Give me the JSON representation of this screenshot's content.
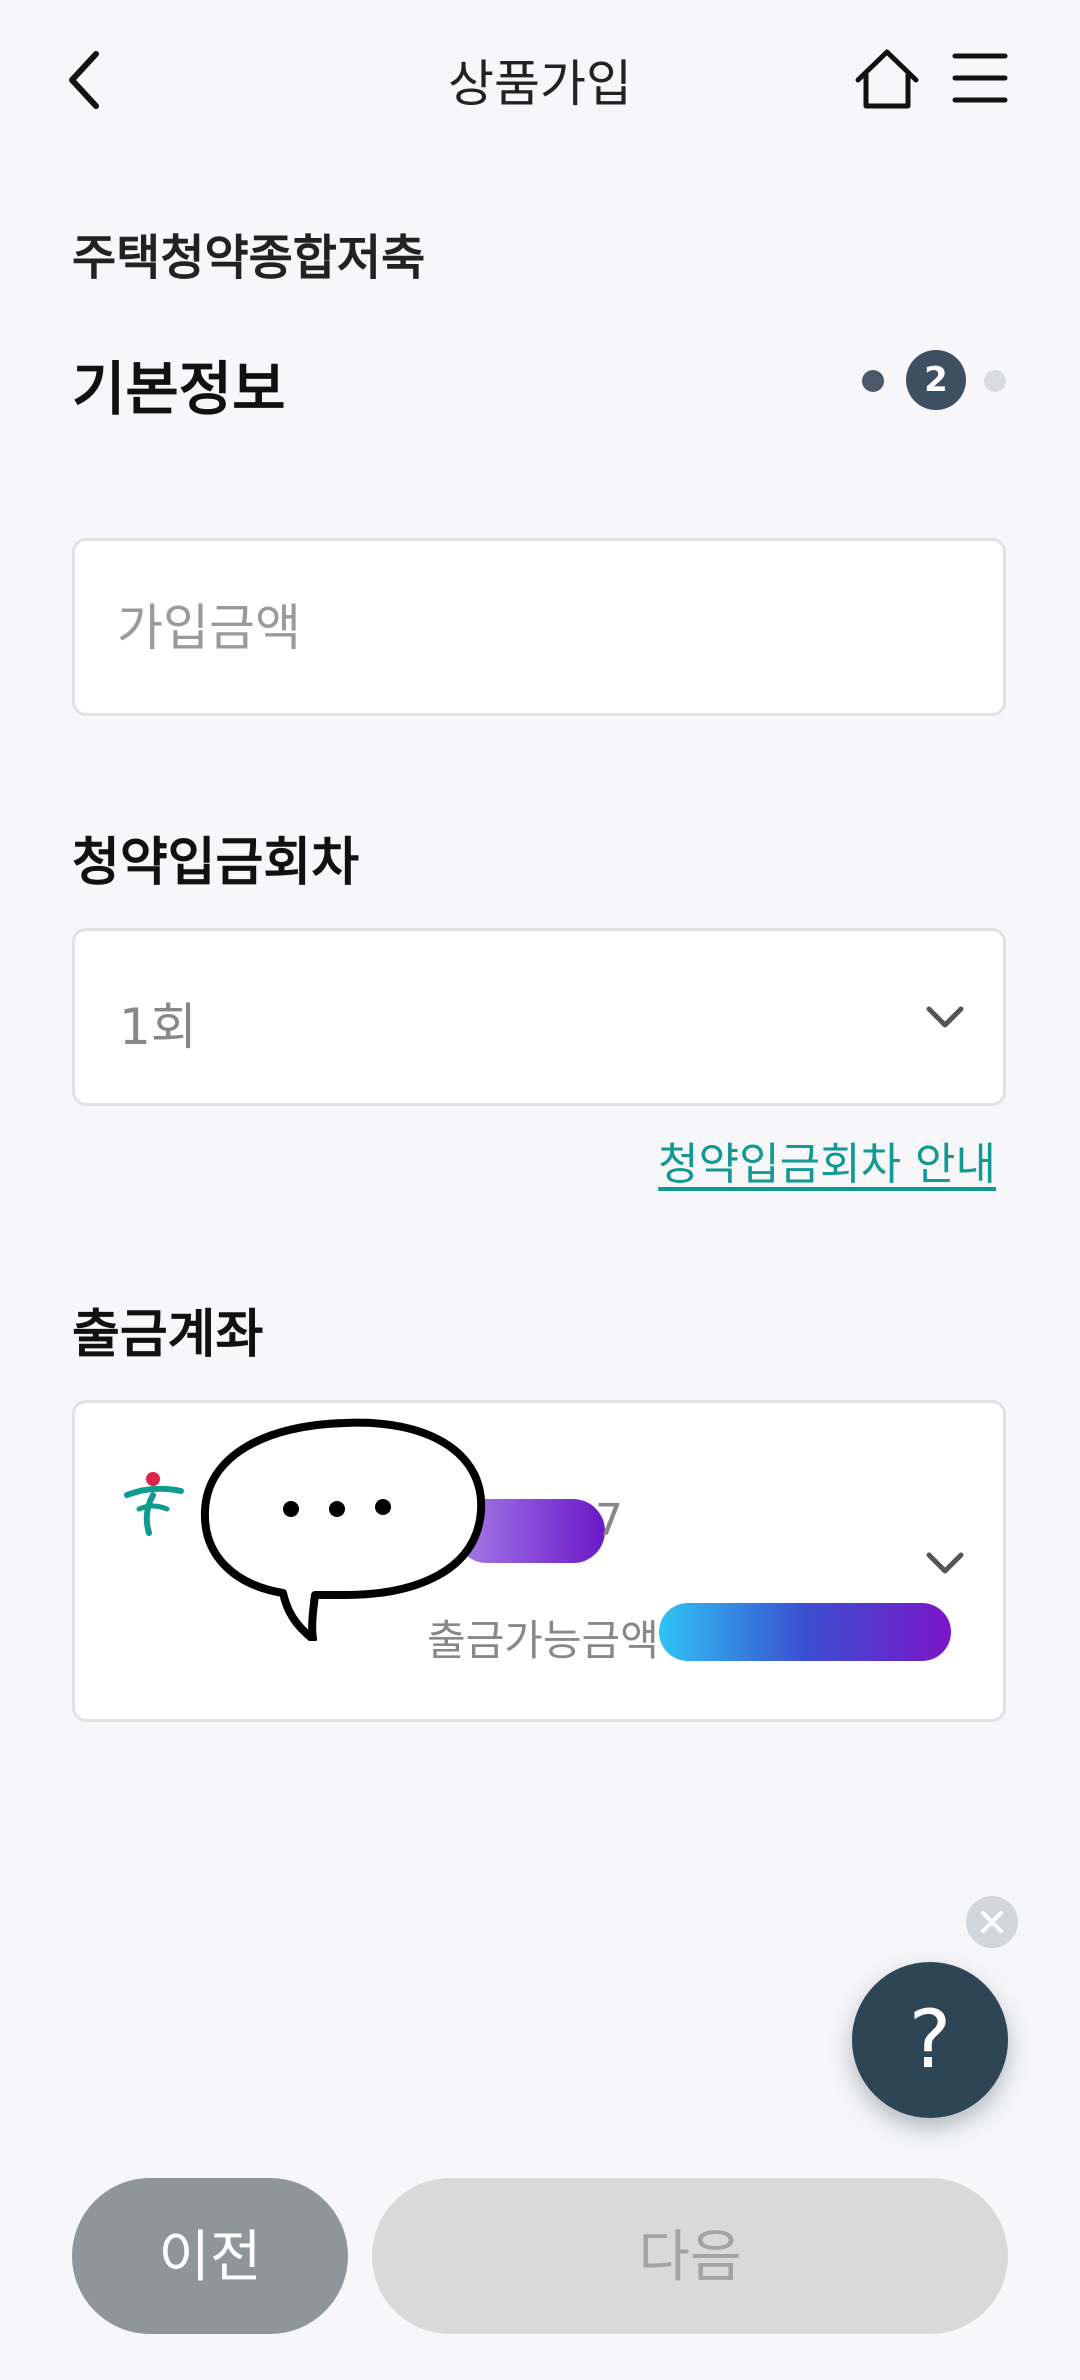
{
  "header": {
    "title": "상품가입",
    "icons": [
      "back-icon",
      "home-icon",
      "menu-icon"
    ]
  },
  "product_name": "주택청약종합저축",
  "section": {
    "title": "기본정보",
    "current_step": "2"
  },
  "amount": {
    "placeholder": "가입금액"
  },
  "deposit_round": {
    "label": "청약입금회차",
    "value": "1회",
    "guide_link": "청약입금회차 안내"
  },
  "account": {
    "label": "출금계좌",
    "number_tail": "7",
    "balance_label": "출금가능금액"
  },
  "help": {
    "label": "?"
  },
  "buttons": {
    "prev": "이전",
    "next": "다음"
  },
  "colors": {
    "accent_link": "#109a93",
    "help_fab": "#2e4556",
    "prev_button": "#8e9699",
    "next_button_disabled": "#d9d9d9"
  }
}
